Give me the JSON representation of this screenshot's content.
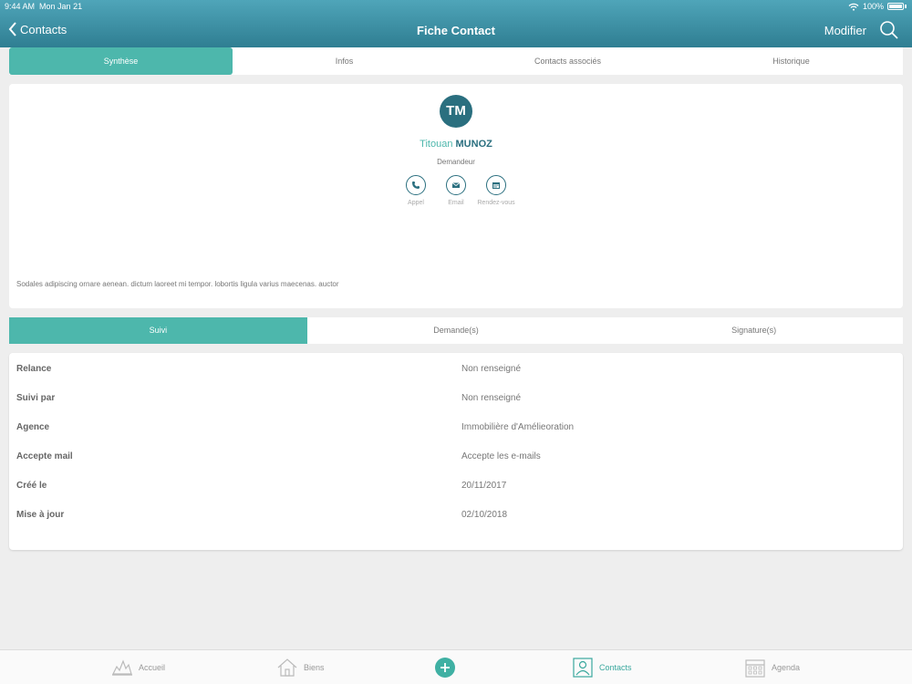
{
  "status": {
    "time": "9:44 AM",
    "date": "Mon Jan 21",
    "battery": "100%"
  },
  "nav": {
    "back_label": "Contacts",
    "title": "Fiche Contact",
    "edit_label": "Modifier"
  },
  "tabs_top": [
    "Synthèse",
    "Infos",
    "Contacts associés",
    "Historique"
  ],
  "profile": {
    "initials": "TM",
    "first_name": "Titouan",
    "last_name": "MUNOZ",
    "role": "Demandeur",
    "actions": [
      "Appel",
      "Email",
      "Rendez-vous"
    ],
    "note": "Sodales adipiscing ornare aenean. dictum laoreet mi tempor. lobortis ligula varius maecenas. auctor"
  },
  "tabs_mid": [
    "Suivi",
    "Demande(s)",
    "Signature(s)"
  ],
  "details": [
    {
      "label": "Relance",
      "value": "Non renseigné"
    },
    {
      "label": "Suivi par",
      "value": "Non renseigné"
    },
    {
      "label": "Agence",
      "value": "Immobilière d'Amélieoration"
    },
    {
      "label": "Accepte mail",
      "value": "Accepte les e-mails"
    },
    {
      "label": "Créé le",
      "value": "20/11/2017"
    },
    {
      "label": "Mise à jour",
      "value": "02/10/2018"
    }
  ],
  "bottom_nav": [
    "Accueil",
    "Biens",
    "Contacts",
    "Agenda"
  ],
  "colors": {
    "accent": "#4db7ac",
    "header": "#2f7e92",
    "avatar": "#2a6f7f"
  }
}
